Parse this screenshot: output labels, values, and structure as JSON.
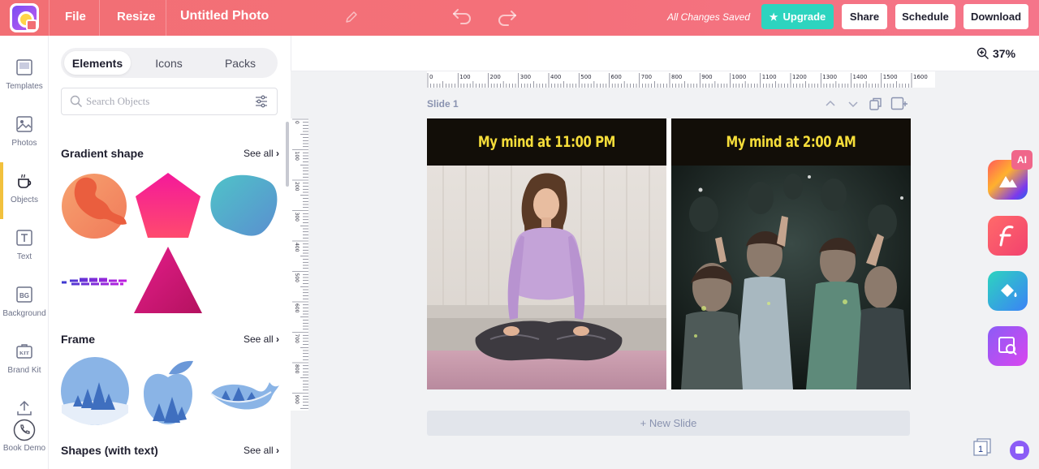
{
  "topbar": {
    "file": "File",
    "resize": "Resize",
    "title": "Untitled Photo",
    "saved_status": "All Changes Saved",
    "upgrade": "Upgrade",
    "share": "Share",
    "schedule": "Schedule",
    "download": "Download"
  },
  "rail": [
    {
      "label": "Templates"
    },
    {
      "label": "Photos"
    },
    {
      "label": "Objects"
    },
    {
      "label": "Text"
    },
    {
      "label": "Background"
    },
    {
      "label": "Brand Kit"
    },
    {
      "label": "Book Demo"
    }
  ],
  "rail_icons": {
    "bg": "BG",
    "kit": "KIT"
  },
  "panel": {
    "tabs": [
      "Elements",
      "Icons",
      "Packs"
    ],
    "search_placeholder": "Search Objects",
    "sections": [
      {
        "title": "Gradient shape",
        "see_all": "See all"
      },
      {
        "title": "Frame",
        "see_all": "See all"
      },
      {
        "title": "Shapes (with text)",
        "see_all": "See all"
      }
    ]
  },
  "canvas": {
    "zoom": "37%",
    "slide_label": "Slide 1",
    "caption_left": "My mind at 11:00 PM",
    "caption_right": "My mind at 2:00 AM",
    "new_slide": "+ New Slide",
    "page_count": "1",
    "ai_badge": "AI"
  },
  "ruler": {
    "h_labels": [
      "0",
      "100",
      "200",
      "300",
      "400",
      "500",
      "600",
      "700",
      "800",
      "900",
      "1000",
      "1100",
      "1200",
      "1300",
      "1400",
      "1500",
      "1600"
    ],
    "v_labels": [
      "0",
      "100",
      "200",
      "300",
      "400",
      "500",
      "600",
      "700",
      "800",
      "900"
    ]
  },
  "colors": {
    "topbar": "#f4707a",
    "upgrade": "#2dd4bf",
    "caption_text": "#f5dd3a",
    "active_rail": "#f2c13d"
  }
}
